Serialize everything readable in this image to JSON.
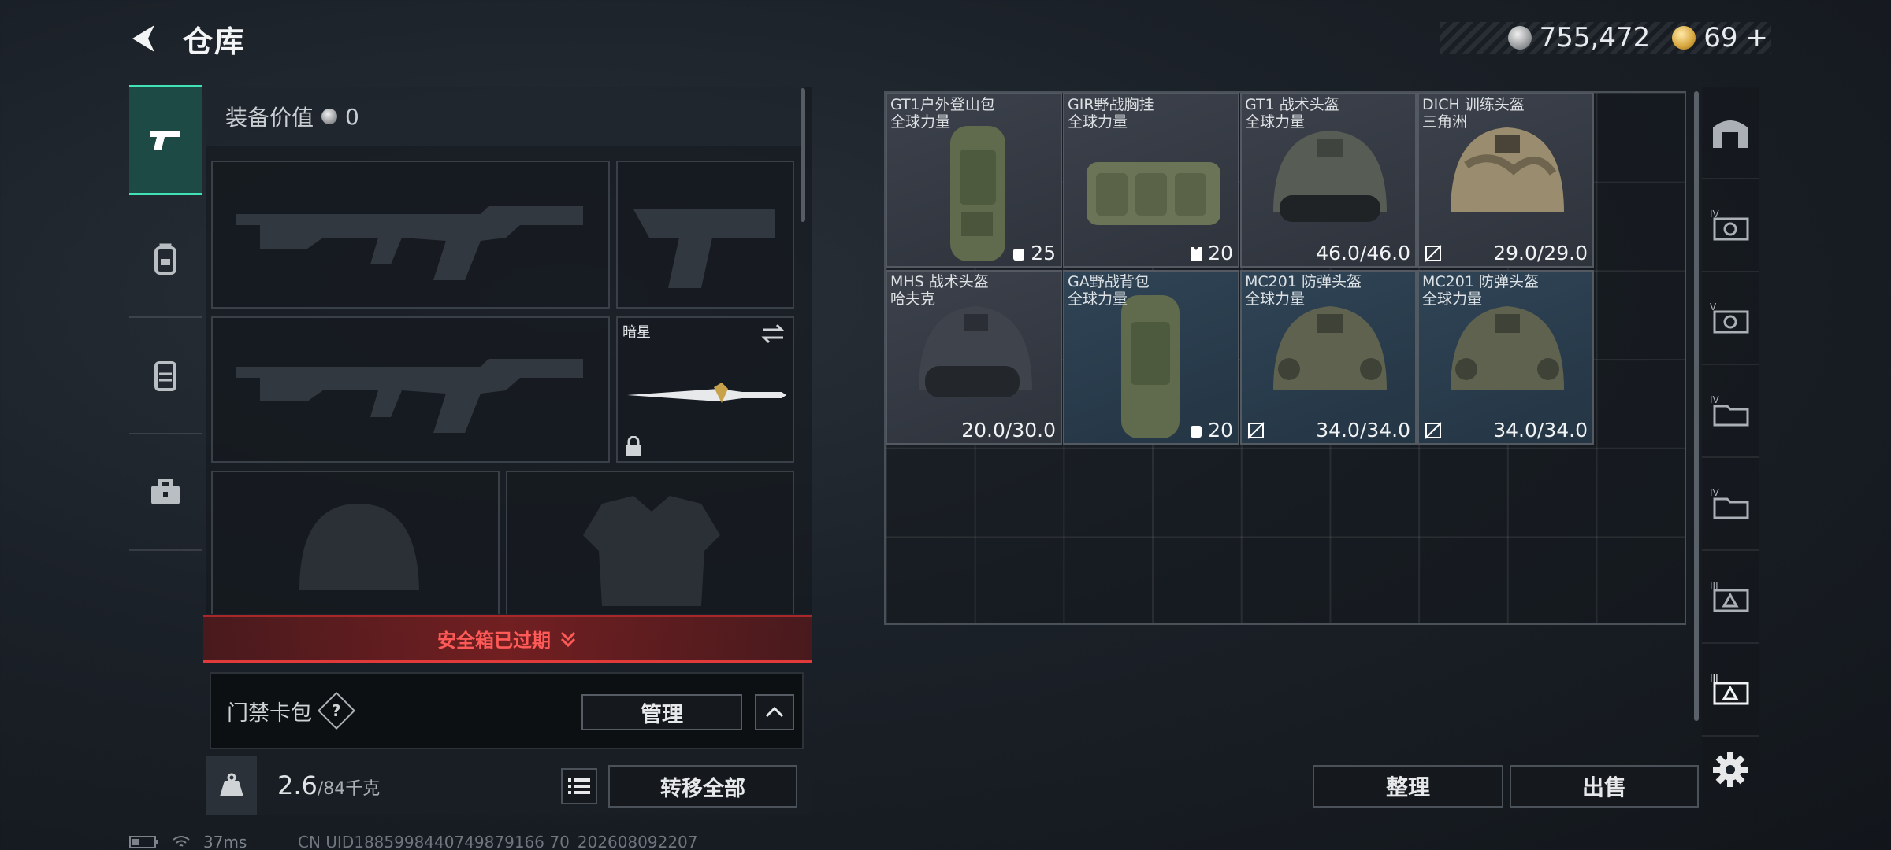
{
  "header": {
    "title": "仓库"
  },
  "currency": {
    "silver": "755,472",
    "gold": "69",
    "gold_plus": "+"
  },
  "equipment": {
    "value_label": "装备价值",
    "value": "0",
    "melee_name": "暗星"
  },
  "safe_box": {
    "status": "安全箱已过期"
  },
  "keycard": {
    "label": "门禁卡包",
    "help": "?",
    "manage": "管理"
  },
  "weight": {
    "current": "2.6",
    "max": "/84千克"
  },
  "transfer_all": "转移全部",
  "items": [
    {
      "name": "GT1户外登山包",
      "sub": "全球力量",
      "stat": "25",
      "stat_icon": "backpack-capacity-icon"
    },
    {
      "name": "GIR野战胸挂",
      "sub": "全球力量",
      "stat": "20",
      "stat_icon": "vest-capacity-icon"
    },
    {
      "name": "GT1 战术头盔",
      "sub": "全球力量",
      "stat": "46.0/46.0",
      "stat_icon": ""
    },
    {
      "name": "DICH 训练头盔",
      "sub": "三角洲",
      "stat": "29.0/29.0",
      "stat_icon": "no-durability-icon"
    },
    {
      "name": "MHS 战术头盔",
      "sub": "哈夫克",
      "stat": "20.0/30.0",
      "stat_icon": ""
    },
    {
      "name": "GA野战背包",
      "sub": "全球力量",
      "stat": "20",
      "stat_icon": "backpack-capacity-icon"
    },
    {
      "name": "MC201 防弹头盔",
      "sub": "全球力量",
      "stat": "34.0/34.0",
      "stat_icon": "no-durability-icon"
    },
    {
      "name": "MC201 防弹头盔",
      "sub": "全球力量",
      "stat": "34.0/34.0",
      "stat_icon": "no-durability-icon"
    }
  ],
  "actions": {
    "sort": "整理",
    "sell": "出售"
  },
  "status_bar": {
    "ping": "37ms",
    "uid": "CN UID1885998440749879166 70_202608092207"
  },
  "colors": {
    "accent": "#43e2b6",
    "alert": "#ff5a57"
  }
}
